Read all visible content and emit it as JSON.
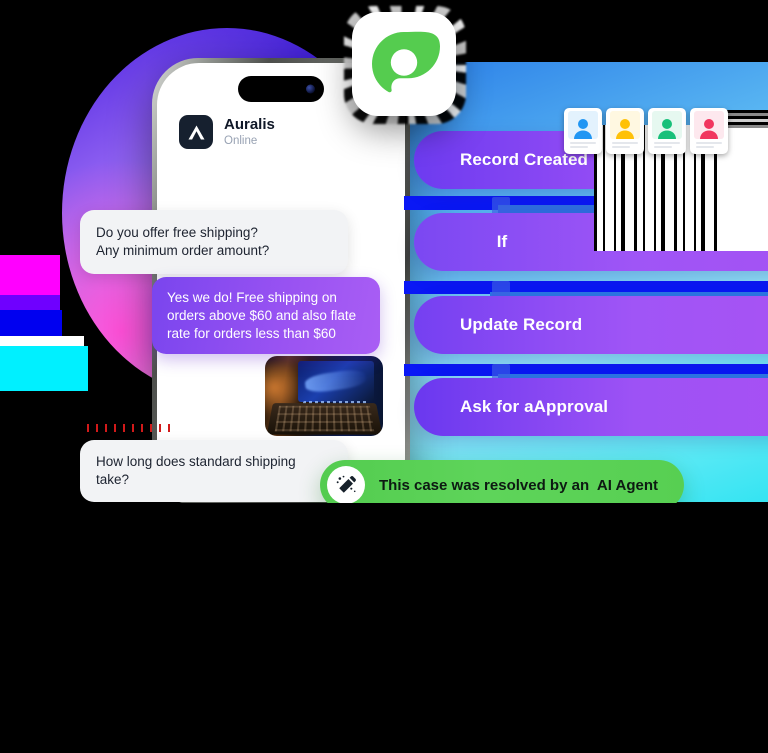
{
  "phone": {
    "status_bar": {
      "signal_icon": "signal-bars-icon"
    },
    "app": {
      "name": "Auralis",
      "status": "Online",
      "logo_icon": "auralis-chevron-logo-icon"
    },
    "messages": [
      {
        "id": "m1",
        "side": "incoming",
        "text": "Do you offer free shipping?\nAny minimum order amount?"
      },
      {
        "id": "m2",
        "side": "outgoing",
        "text": "Yes we do! Free shipping on orders above $60 and also flate rate for orders less than $60"
      },
      {
        "id": "m3",
        "side": "incoming",
        "type": "image",
        "alt_icon": "laptop-photo-attachment"
      },
      {
        "id": "m4",
        "side": "incoming",
        "text": "How long does standard shipping take?"
      }
    ]
  },
  "floating_logo": {
    "icon": "auralis-green-bubble-logo-icon"
  },
  "workflow": {
    "cards": [
      {
        "label": "Record Created"
      },
      {
        "label": "If"
      },
      {
        "label": "Update Record"
      },
      {
        "label": "Ask for aApproval"
      }
    ]
  },
  "avatars": [
    {
      "name": "avatar-card-blue",
      "color": "#2196f3",
      "bg": "#e3f2fd"
    },
    {
      "name": "avatar-card-yellow",
      "color": "#ffc107",
      "bg": "#fff8e1"
    },
    {
      "name": "avatar-card-green",
      "color": "#18c07a",
      "bg": "#e6f8f0"
    },
    {
      "name": "avatar-card-pink",
      "color": "#f1365f",
      "bg": "#fde8ee"
    }
  ],
  "banner": {
    "text": "This case was resolved by an  AI Agent",
    "icon": "magic-wand-icon",
    "color": "#57cf52"
  },
  "colors": {
    "accent_purple": "#8a4ff5",
    "accent_green": "#57cf52",
    "panel_blue": "#59b6f2",
    "bubble_grey": "#f2f3f5"
  }
}
